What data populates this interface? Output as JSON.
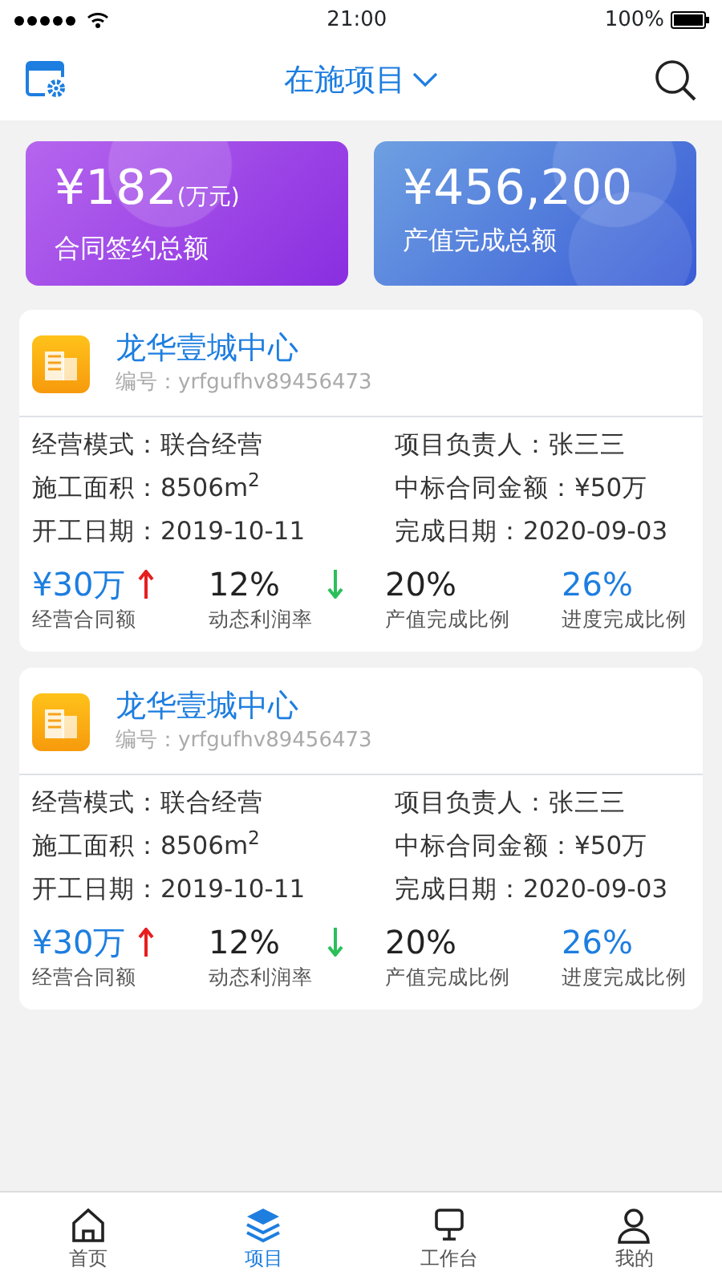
{
  "status_bar": {
    "time": "21:00",
    "battery": "100%"
  },
  "header": {
    "title": "在施项目"
  },
  "summary": [
    {
      "kind": "purple",
      "amount": "¥182",
      "unit": "(万元)",
      "label": "合同签约总额"
    },
    {
      "kind": "blue",
      "amount": "¥456,200",
      "label": "产值完成总额"
    }
  ],
  "projects": [
    {
      "name": "龙华壹城中心",
      "code": "编号：yrfgufhv89456473",
      "fields": [
        {
          "label": "经营模式：",
          "value": "联合经营"
        },
        {
          "label": "项目负责人：",
          "value": "张三三"
        },
        {
          "label": "施工面积：",
          "value": "8506m$^{2}$"
        },
        {
          "label": "中标合同金额：",
          "value": "¥50万"
        },
        {
          "label": "开工日期：",
          "value": "2019-10-11"
        },
        {
          "label": "完成日期：",
          "value": "2020-09-03"
        }
      ],
      "stats": [
        {
          "value": "¥30万",
          "label": "经营合同额",
          "accent": true,
          "kind": "rising"
        },
        {
          "value": "12%",
          "label": "动态利润率",
          "accent": false,
          "kind": "falling"
        },
        {
          "value": "20%",
          "label": "产值完成比例",
          "accent": false,
          "kind": "plain"
        },
        {
          "value": "26%",
          "label": "进度完成比例",
          "accent": true,
          "kind": "plain"
        }
      ]
    },
    {
      "name": "龙华壹城中心",
      "code": "编号：yrfgufhv89456473",
      "fields": [
        {
          "label": "经营模式：",
          "value": "联合经营"
        },
        {
          "label": "项目负责人：",
          "value": "张三三"
        },
        {
          "label": "施工面积：",
          "value": "8506m$^{2}$"
        },
        {
          "label": "中标合同金额：",
          "value": "¥50万"
        },
        {
          "label": "开工日期：",
          "value": "2019-10-11"
        },
        {
          "label": "完成日期：",
          "value": "2020-09-03"
        }
      ],
      "stats": [
        {
          "value": "¥30万",
          "label": "经营合同额",
          "accent": true,
          "kind": "rising"
        },
        {
          "value": "12%",
          "label": "动态利润率",
          "accent": false,
          "kind": "falling"
        },
        {
          "value": "20%",
          "label": "产值完成比例",
          "accent": false,
          "kind": "plain"
        },
        {
          "value": "26%",
          "label": "进度完成比例",
          "accent": true,
          "kind": "plain"
        }
      ]
    }
  ],
  "tabbar": [
    {
      "kind": "home",
      "label": "首页",
      "selected": false
    },
    {
      "kind": "layers",
      "label": "项目",
      "selected": true
    },
    {
      "kind": "desk",
      "label": "工作台",
      "selected": false
    },
    {
      "kind": "user",
      "label": "我的",
      "selected": false
    }
  ]
}
